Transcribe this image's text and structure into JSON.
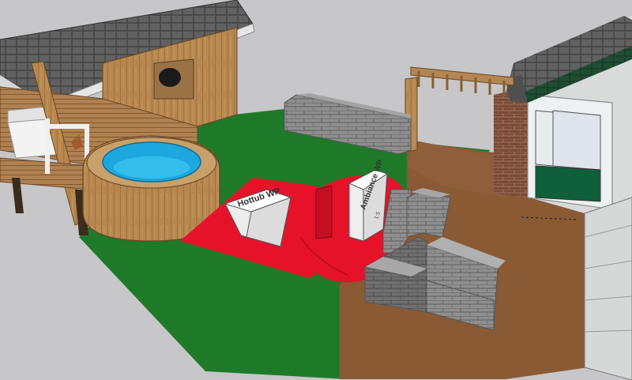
{
  "viewport": {
    "name": "3D model viewport"
  },
  "model": {
    "labels": {
      "hottub_box": "Hottub WP",
      "ambiance_box": "Ambiance WP",
      "ambiance_sub": "1:5"
    },
    "colors": {
      "sky": "#c7c7c9",
      "grass": "#1e7a29",
      "soil": "#8a5a35",
      "clearance_zone": "#e5122a",
      "tub_water": "#2ab6e8",
      "wood": "#b88a52",
      "brick": "#8c8c8c",
      "roof": "#5d5d5d"
    }
  }
}
